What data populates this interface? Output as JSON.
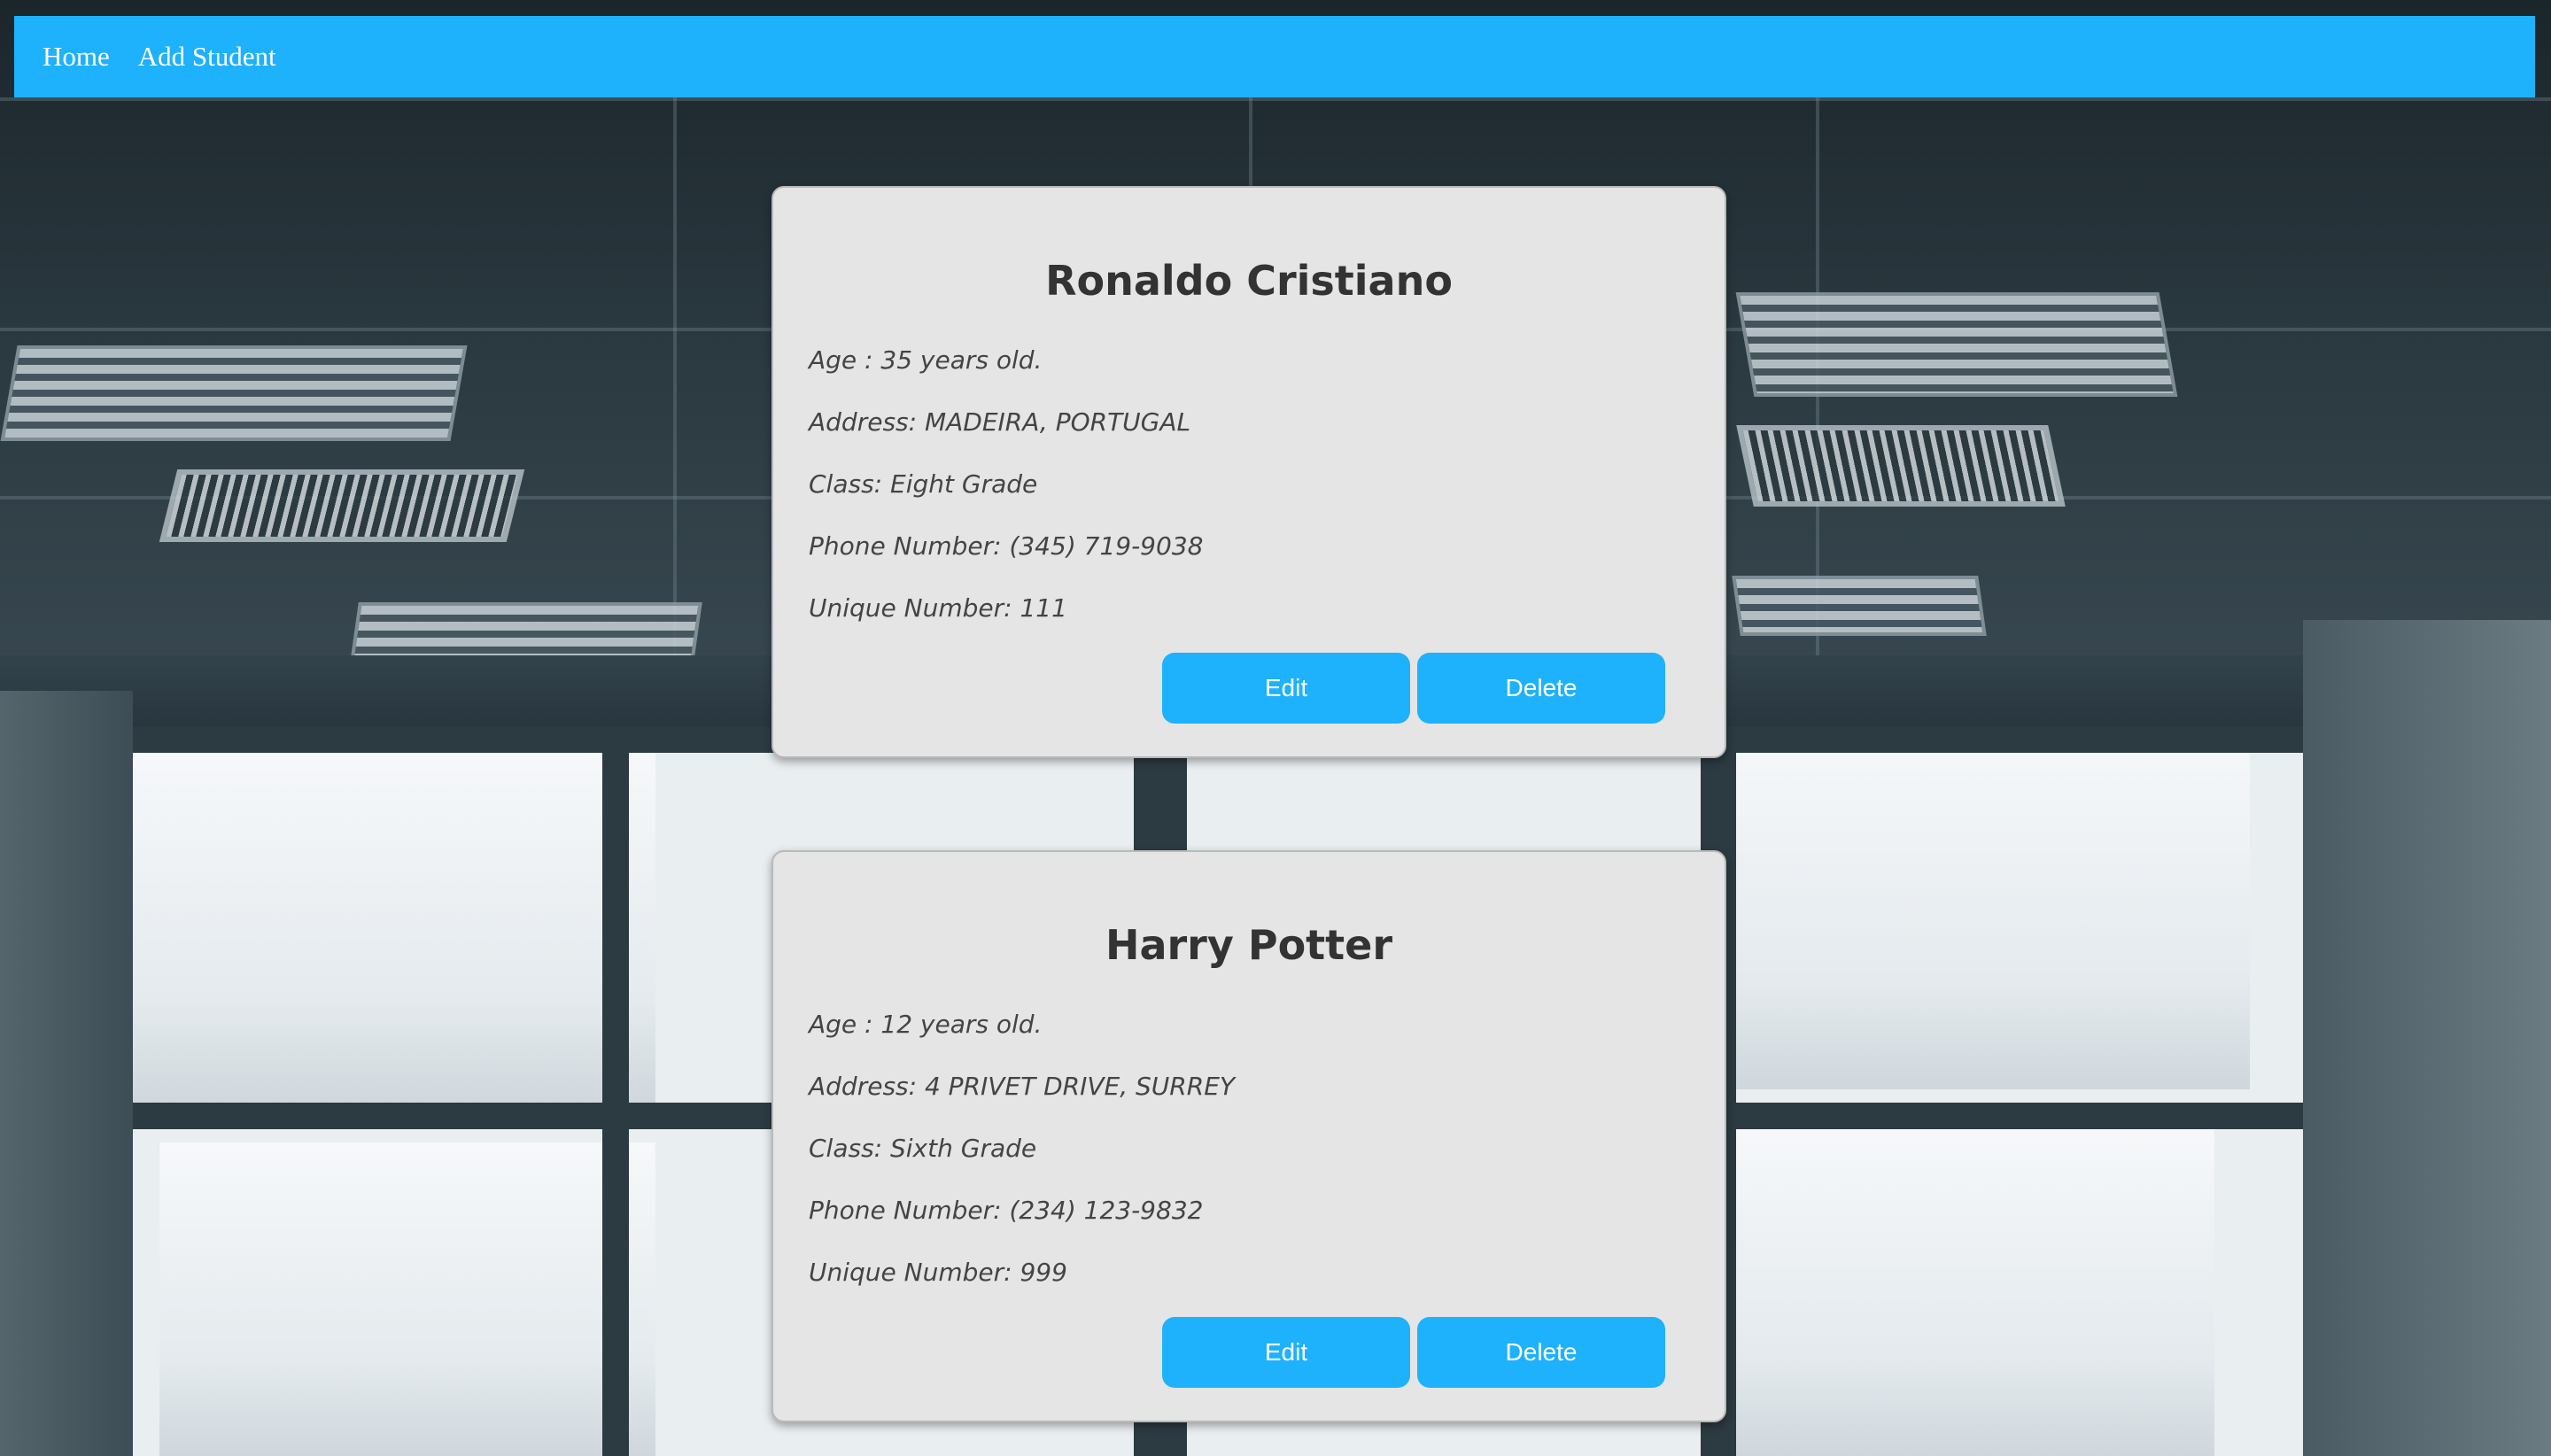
{
  "nav": {
    "home_label": "Home",
    "add_student_label": "Add Student"
  },
  "students": [
    {
      "name": "Ronaldo Cristiano",
      "age": "Age : 35 years old.",
      "address": "Address: MADEIRA, PORTUGAL",
      "class": "Class: Eight Grade",
      "phone": "Phone Number: (345) 719-9038",
      "unique": "Unique Number: 111",
      "edit_label": "Edit",
      "delete_label": "Delete"
    },
    {
      "name": "Harry Potter",
      "age": "Age : 12 years old.",
      "address": "Address: 4 PRIVET DRIVE, SURREY",
      "class": "Class: Sixth Grade",
      "phone": "Phone Number: (234) 123-9832",
      "unique": "Unique Number: 999",
      "edit_label": "Edit",
      "delete_label": "Delete"
    }
  ],
  "colors": {
    "accent": "#1eb1fc",
    "card_background": "#e5e5e5",
    "title_text": "#333333",
    "body_text": "#444444"
  }
}
